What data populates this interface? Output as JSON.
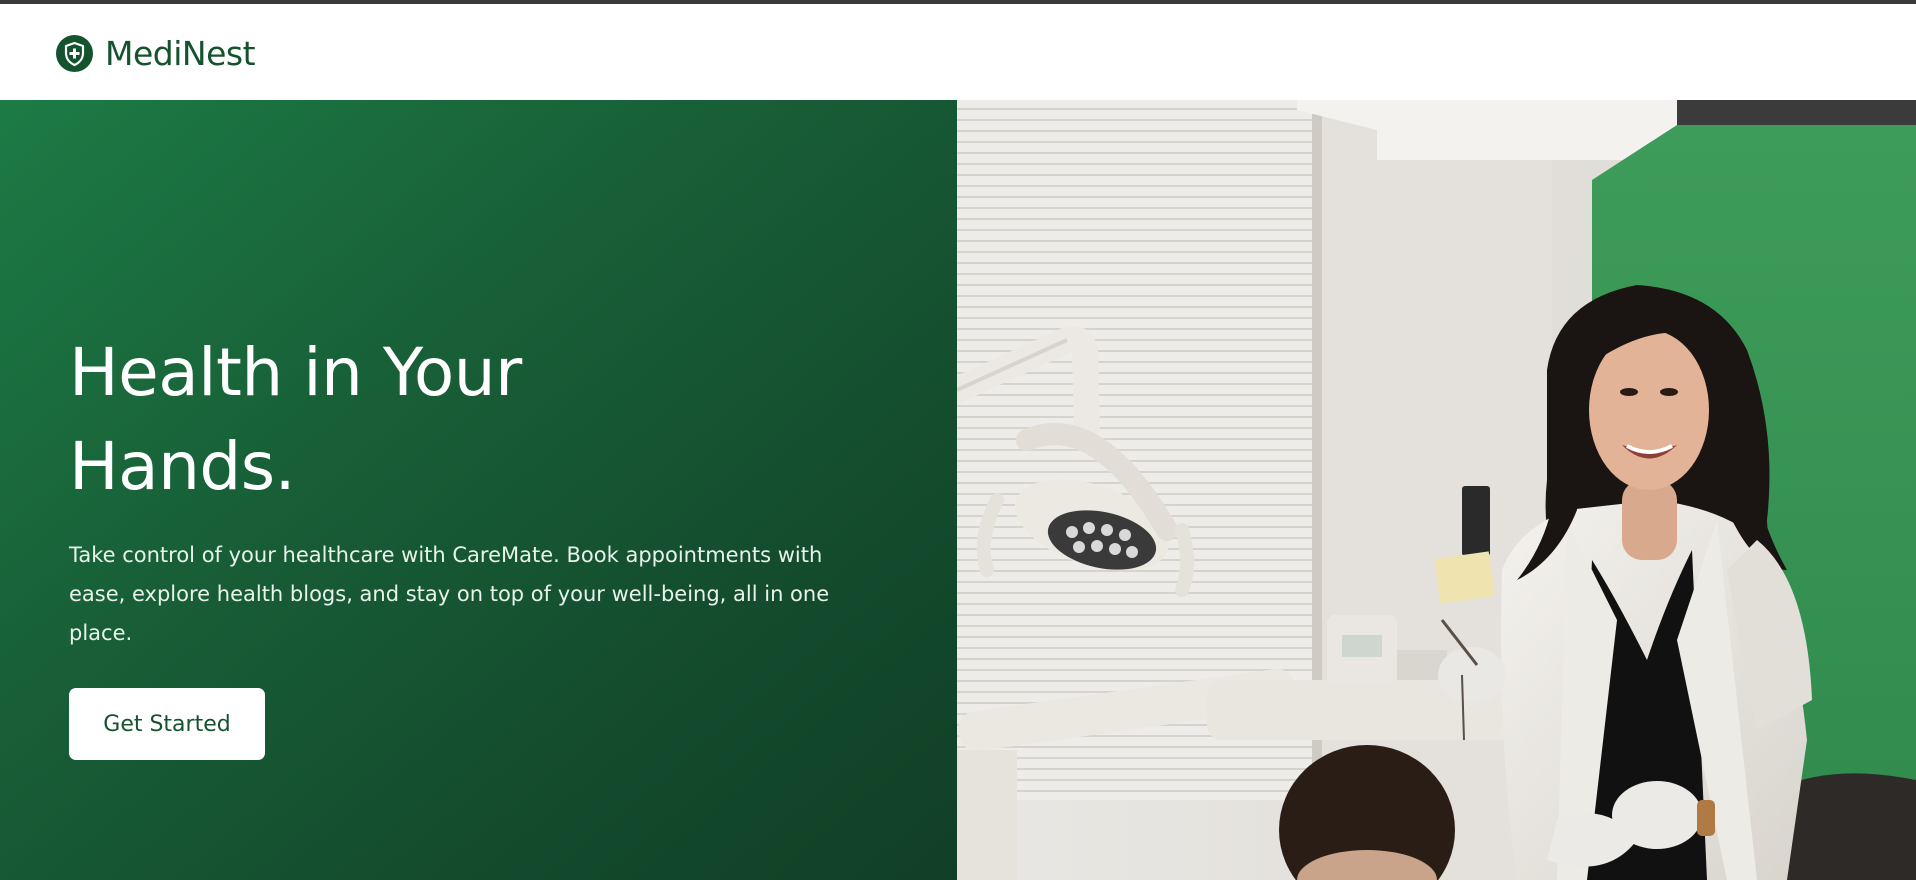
{
  "brand": {
    "name": "MediNest",
    "logo_icon": "shield-plus-icon",
    "color": "#14532d"
  },
  "hero": {
    "title_lines": [
      "Health in Your",
      "Hands."
    ],
    "subtitle_lines": [
      "Take control of your healthcare with CareMate. Book appointments with",
      "ease, explore health blogs, and stay on top of your well-being, all in one",
      "place."
    ],
    "cta_label": "Get Started",
    "background_colors": [
      "#1c7b45",
      "#113f26"
    ],
    "photo_alt": "Smiling dentist in a white coat standing beside a dental chair with a patient"
  }
}
